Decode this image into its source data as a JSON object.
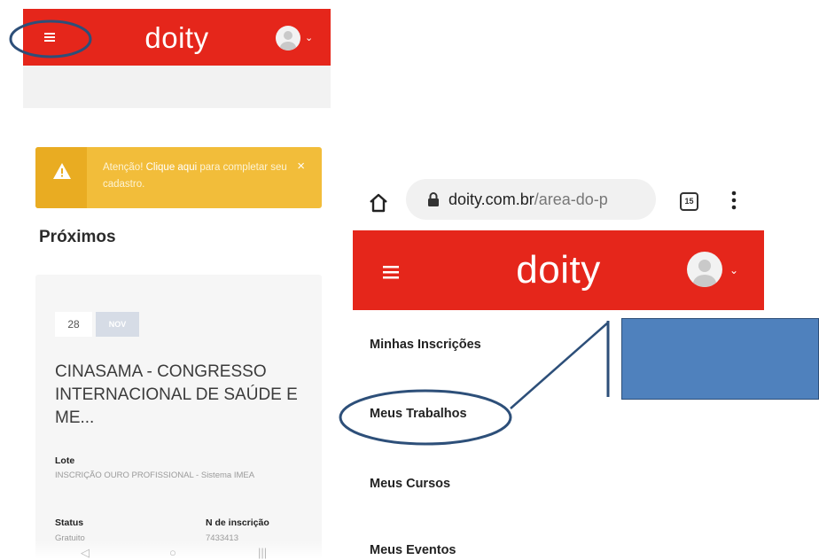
{
  "left_screen": {
    "header": {
      "logo": "doity",
      "caret": "⌄"
    },
    "alert": {
      "prefix": "Atenção!",
      "link": "Clique aqui",
      "suffix": "para completar seu cadastro.",
      "close": "×"
    },
    "section_title": "Próximos",
    "event": {
      "day": "28",
      "month": "NOV",
      "title": "CINASAMA - CONGRESSO INTERNACIONAL DE SAÚDE E ME...",
      "lote_label": "Lote",
      "lote_value": "INSCRIÇÃO OURO PROFISSIONAL - Sistema IMEA",
      "status_label": "Status",
      "status_value": "Gratuito",
      "inscricao_label": "N de inscrição",
      "inscricao_value": "7433413"
    },
    "nav": {
      "back": "◁",
      "home": "○",
      "recents": "|||"
    }
  },
  "right_screen": {
    "browser": {
      "url_domain": "doity.com.br",
      "url_path": "/area-do-p",
      "tab_count": "15"
    },
    "header": {
      "logo": "doity",
      "caret": "⌄"
    },
    "menu": [
      {
        "label": "Minhas Inscrições"
      },
      {
        "label": "Meus Trabalhos"
      },
      {
        "label": "Meus Cursos"
      },
      {
        "label": "Meus Eventos"
      }
    ]
  },
  "colors": {
    "brand_red": "#e5261b",
    "alert_yellow": "#f2bd3a",
    "annotation_blue": "#4f81bd",
    "annotation_stroke": "#2d4f79"
  },
  "icons": [
    "hamburger-icon",
    "avatar-icon",
    "warning-icon",
    "home-icon",
    "lock-icon",
    "kebab-icon"
  ]
}
